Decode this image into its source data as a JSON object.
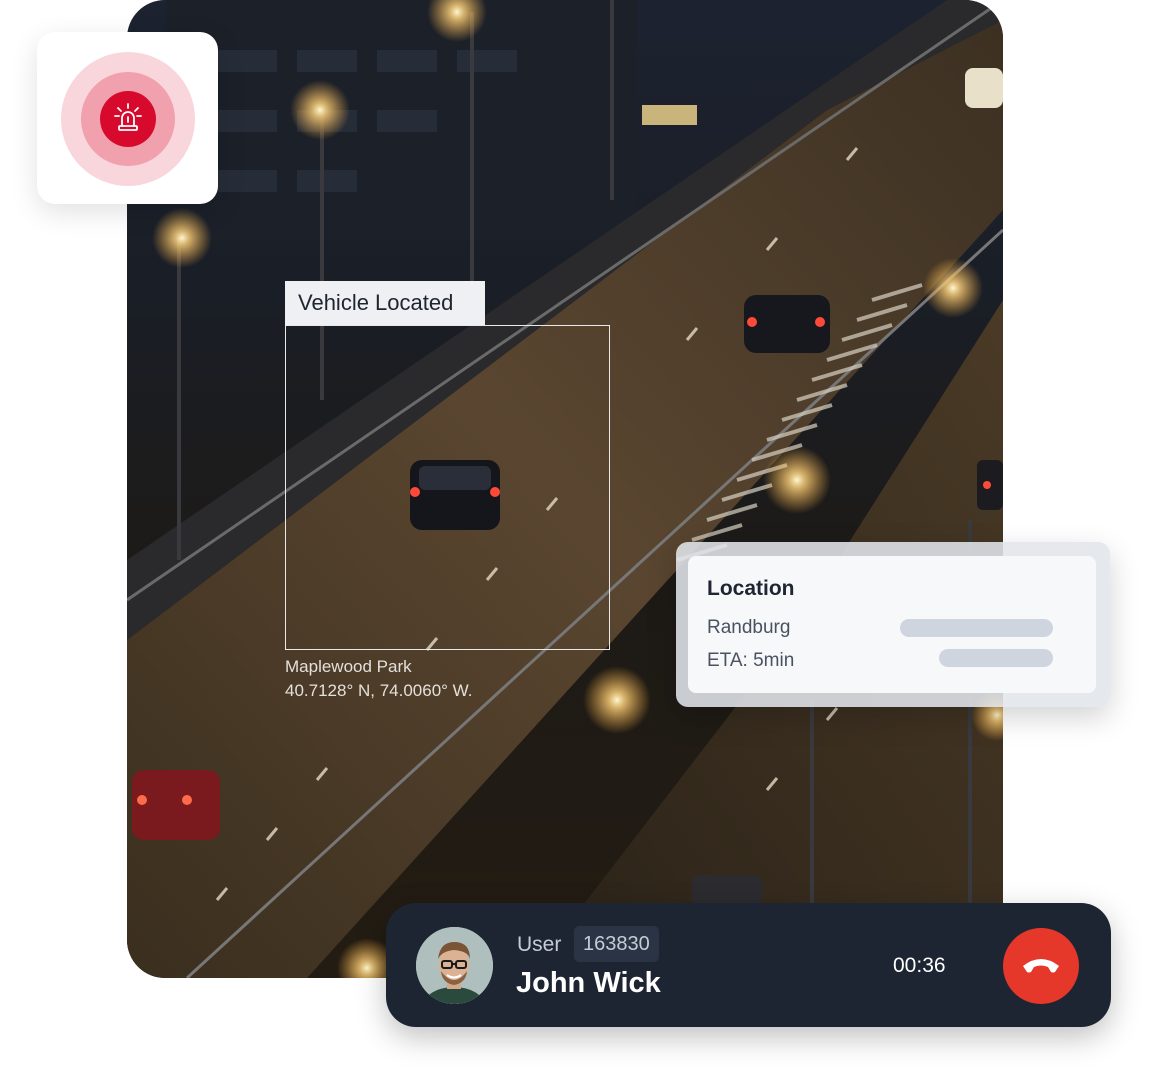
{
  "detection": {
    "label": "Vehicle Located",
    "place": "Maplewood Park",
    "coordinates": "40.7128° N, 74.0060° W."
  },
  "location_card": {
    "title": "Location",
    "city": "Randburg",
    "eta": "ETA: 5min"
  },
  "call": {
    "user_label": "User",
    "user_id": "163830",
    "name": "John Wick",
    "timer": "00:36",
    "hangup_icon": "phone-hangup-icon"
  },
  "alert": {
    "icon": "siren-icon",
    "color": "#d7092c"
  },
  "colors": {
    "call_bar": "#1d2533",
    "hangup": "#e5382a",
    "alert_red": "#d7092c"
  }
}
